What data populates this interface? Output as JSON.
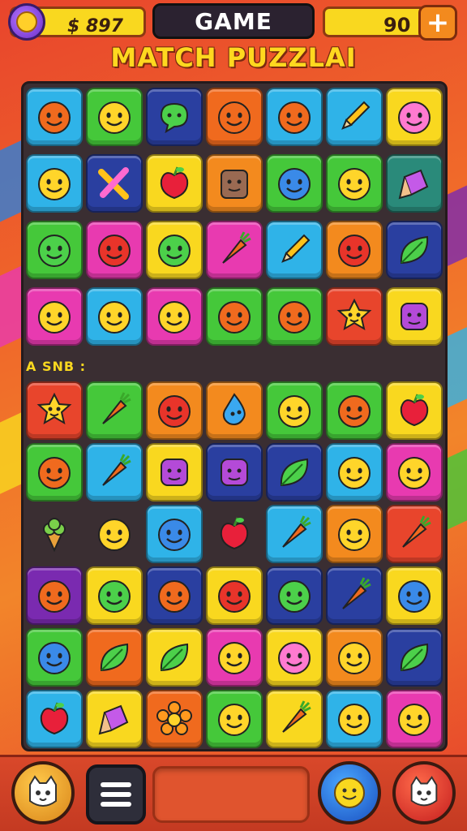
{
  "header": {
    "coin_value": "$ 897",
    "title": "GAME",
    "score": "90",
    "plus_label": "+",
    "subtitle": "MATCH PUZZLAI"
  },
  "board": {
    "divider_label": "A SNB :",
    "top_rows": [
      [
        [
          "#2fb3e8",
          "orange-face"
        ],
        [
          "#45c83a",
          "yellow-face"
        ],
        [
          "#2a3fa0",
          "speech-bubble"
        ],
        [
          "#f06a1e",
          "orange-face"
        ],
        [
          "#2fb3e8",
          "orange-face"
        ],
        [
          "#2fb3e8",
          "pencil"
        ],
        [
          "#f9d81f",
          "pink-face"
        ]
      ],
      [
        [
          "#2fb3e8",
          "yellow-face"
        ],
        [
          "#2a3fa0",
          "pencil-cross"
        ],
        [
          "#f9d81f",
          "red-apple"
        ],
        [
          "#f38a1e",
          "brown-face"
        ],
        [
          "#45c83a",
          "blue-face"
        ],
        [
          "#45c83a",
          "yellow-face"
        ],
        [
          "#2a8a7a",
          "purple-gem"
        ]
      ],
      [
        [
          "#45c83a",
          "green-face"
        ],
        [
          "#e83ab0",
          "red-face"
        ],
        [
          "#f9d81f",
          "green-face"
        ],
        [
          "#e83ab0",
          "carrot"
        ],
        [
          "#2fb3e8",
          "pencil"
        ],
        [
          "#f38a1e",
          "red-face"
        ],
        [
          "#2a3fa0",
          "leaf"
        ]
      ],
      [
        [
          "#e83ab0",
          "yellow-face"
        ],
        [
          "#2fb3e8",
          "yellow-face"
        ],
        [
          "#e83ab0",
          "yellow-face"
        ],
        [
          "#45c83a",
          "orange-face"
        ],
        [
          "#45c83a",
          "orange-face"
        ],
        [
          "#e8452c",
          "star-face"
        ],
        [
          "#f9d81f",
          "purple-face"
        ]
      ]
    ],
    "bottom_rows": [
      [
        [
          "#e8452c",
          "star-face"
        ],
        [
          "#45c83a",
          "carrot"
        ],
        [
          "#f38a1e",
          "red-face"
        ],
        [
          "#f38a1e",
          "blue-drop"
        ],
        [
          "#45c83a",
          "yellow-face"
        ],
        [
          "#45c83a",
          "orange-face"
        ],
        [
          "#f9d81f",
          "red-apple"
        ]
      ],
      [
        [
          "#45c83a",
          "orange-face"
        ],
        [
          "#2fb3e8",
          "carrot"
        ],
        [
          "#f9d81f",
          "purple-face"
        ],
        [
          "#2a3fa0",
          "purple-face"
        ],
        [
          "#2a3fa0",
          "leaf"
        ],
        [
          "#2fb3e8",
          "yellow-face"
        ],
        [
          "#e83ab0",
          "yellow-face"
        ]
      ],
      [
        [
          "none",
          "ice-cream"
        ],
        [
          "none",
          "yellow-face"
        ],
        [
          "#2fb3e8",
          "blue-face"
        ],
        [
          "none",
          "red-apple"
        ],
        [
          "#2fb3e8",
          "carrot"
        ],
        [
          "#f38a1e",
          "yellow-face"
        ],
        [
          "#e8452c",
          "carrot"
        ]
      ],
      [
        [
          "#7a2ab0",
          "orange-face"
        ],
        [
          "#f9d81f",
          "green-face"
        ],
        [
          "#2a3fa0",
          "orange-face"
        ],
        [
          "#f9d81f",
          "red-face"
        ],
        [
          "#2a3fa0",
          "green-face"
        ],
        [
          "#2a3fa0",
          "carrot"
        ],
        [
          "#f9d81f",
          "blue-face"
        ]
      ],
      [
        [
          "#45c83a",
          "blue-face"
        ],
        [
          "#f06a1e",
          "leaf"
        ],
        [
          "#f9d81f",
          "leaf"
        ],
        [
          "#e83ab0",
          "yellow-face"
        ],
        [
          "#f9d81f",
          "pink-face"
        ],
        [
          "#f38a1e",
          "yellow-face"
        ],
        [
          "#2a3fa0",
          "leaf"
        ]
      ],
      [
        [
          "#2fb3e8",
          "red-apple"
        ],
        [
          "#f9d81f",
          "purple-gem"
        ],
        [
          "#f06a1e",
          "orange-flower"
        ],
        [
          "#45c83a",
          "yellow-face"
        ],
        [
          "#f9d81f",
          "carrot"
        ],
        [
          "#2fb3e8",
          "yellow-face"
        ],
        [
          "#e83ab0",
          "yellow-face"
        ]
      ]
    ]
  },
  "colors": {
    "accent_yellow": "#f9d81f",
    "board_bg": "#3a2e32",
    "bg_red": "#e8452c"
  },
  "bottom_bar": {
    "left_button_icon": "cat-face-icon",
    "menu_icon": "hamburger-menu-icon",
    "right_button_1_icon": "smiley-face-icon",
    "right_button_2_icon": "cat-face-icon"
  }
}
